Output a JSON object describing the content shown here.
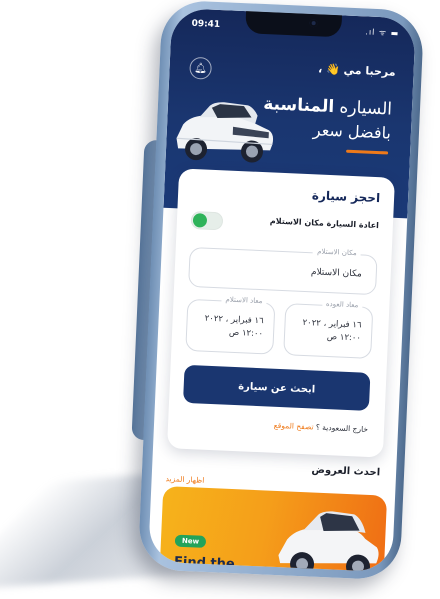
{
  "status_bar": {
    "time": "09:41",
    "icons": ".ıl ᯤ ▬"
  },
  "header": {
    "greeting": "مرحبا مي 👋 ،",
    "bell_icon": "bell-icon",
    "hero_line1_normal": "السياره ",
    "hero_line1_bold": "المناسبة",
    "hero_line2": "بافضل سعر"
  },
  "booking": {
    "title": "احجز سيارة",
    "return_same_place_label": "اعادة السيارة مكان الاستلام",
    "toggle_on": true,
    "pickup_place": {
      "label": "مكان الاستلام",
      "value": "مكان الاستلام"
    },
    "return_date": {
      "label": "معاد العوده",
      "date": "١٦ فبراير ، ٢٠٢٢",
      "time": "١٢:٠٠ ص"
    },
    "pickup_date": {
      "label": "معاد الاستلام",
      "date": "١٦ فبراير ، ٢٠٢٢",
      "time": "١٢:٠٠ ص"
    },
    "search_button": "ابحث عن سيارة",
    "outside_question": "خارج السعودية ؟",
    "outside_link": "تصفح الموقع"
  },
  "offers": {
    "title": "احدث العروض",
    "show_more": "اظهار المزيد",
    "promo_badge": "New",
    "promo_title": "Find the"
  },
  "colors": {
    "navy": "#1a3670",
    "accent_orange": "#ef7a1a",
    "toggle_green": "#2fb35a"
  }
}
